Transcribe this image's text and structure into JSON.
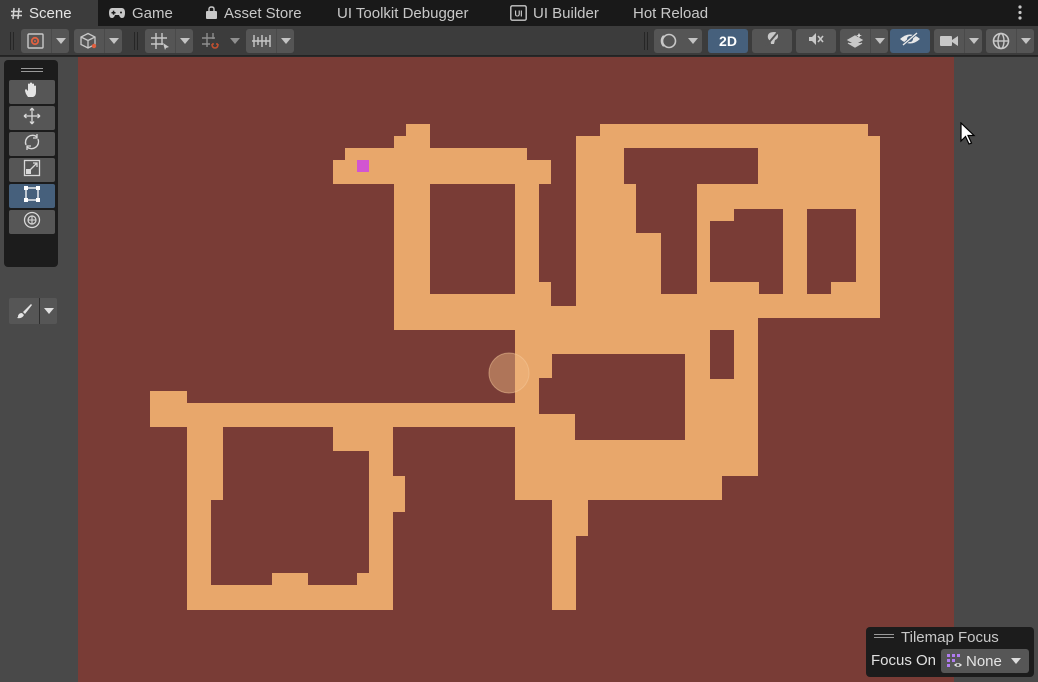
{
  "tabs": [
    {
      "label": "Scene",
      "icon": "hash-icon",
      "active": true
    },
    {
      "label": "Game",
      "icon": "gamepad-icon",
      "active": false
    },
    {
      "label": "Asset Store",
      "icon": "shopping-bag-icon",
      "active": false
    },
    {
      "label": "UI Toolkit Debugger",
      "icon": "",
      "active": false
    },
    {
      "label": "UI Builder",
      "icon": "ui-builder-icon",
      "active": false
    },
    {
      "label": "Hot Reload",
      "icon": "",
      "active": false
    }
  ],
  "toolbar": {
    "mode_2d_label": "2D",
    "mode_2d_active": true,
    "scene_visibility_active": true,
    "icons": [
      "draw-mode-icon",
      "shading-cube-icon",
      "grid-snap-icon",
      "increment-snap-icon",
      "grid-ruler-icon",
      "orbit-camera-icon",
      "lighting-icon",
      "audio-mute-icon",
      "effects-layers-icon",
      "scene-visibility-icon",
      "camera-icon",
      "gizmos-icon"
    ]
  },
  "tools": {
    "items": [
      "hand-tool-icon",
      "move-tool-icon",
      "rotate-tool-icon",
      "scale-tool-icon",
      "rect-tool-icon",
      "transform-tool-icon"
    ],
    "active_index": 4,
    "brush_icon": "paint-brush-icon"
  },
  "tilemap_focus": {
    "title": "Tilemap Focus",
    "focus_on_label": "Focus On",
    "value": "None",
    "value_icon": "tilemap-grid-icon"
  },
  "scene": {
    "background_color": "#793c36",
    "floor_color": "#e8a76b",
    "marker_color": "#d255d2",
    "viewport_bg": "#494949"
  }
}
